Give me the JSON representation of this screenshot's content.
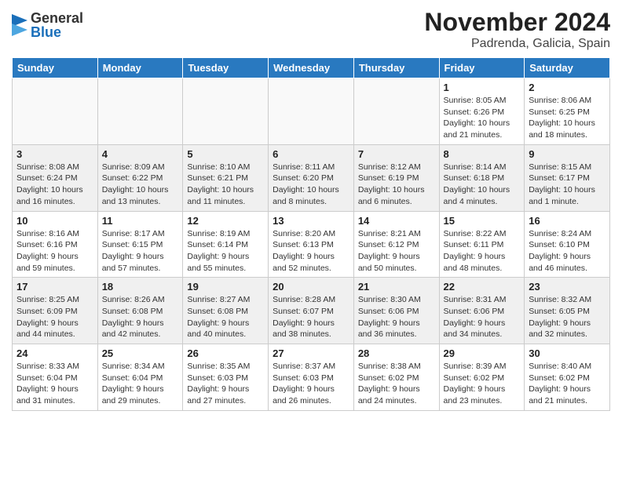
{
  "header": {
    "logo_general": "General",
    "logo_blue": "Blue",
    "month_title": "November 2024",
    "location": "Padrenda, Galicia, Spain"
  },
  "days_of_week": [
    "Sunday",
    "Monday",
    "Tuesday",
    "Wednesday",
    "Thursday",
    "Friday",
    "Saturday"
  ],
  "weeks": [
    [
      {
        "day": "",
        "info": ""
      },
      {
        "day": "",
        "info": ""
      },
      {
        "day": "",
        "info": ""
      },
      {
        "day": "",
        "info": ""
      },
      {
        "day": "",
        "info": ""
      },
      {
        "day": "1",
        "info": "Sunrise: 8:05 AM\nSunset: 6:26 PM\nDaylight: 10 hours and 21 minutes."
      },
      {
        "day": "2",
        "info": "Sunrise: 8:06 AM\nSunset: 6:25 PM\nDaylight: 10 hours and 18 minutes."
      }
    ],
    [
      {
        "day": "3",
        "info": "Sunrise: 8:08 AM\nSunset: 6:24 PM\nDaylight: 10 hours and 16 minutes."
      },
      {
        "day": "4",
        "info": "Sunrise: 8:09 AM\nSunset: 6:22 PM\nDaylight: 10 hours and 13 minutes."
      },
      {
        "day": "5",
        "info": "Sunrise: 8:10 AM\nSunset: 6:21 PM\nDaylight: 10 hours and 11 minutes."
      },
      {
        "day": "6",
        "info": "Sunrise: 8:11 AM\nSunset: 6:20 PM\nDaylight: 10 hours and 8 minutes."
      },
      {
        "day": "7",
        "info": "Sunrise: 8:12 AM\nSunset: 6:19 PM\nDaylight: 10 hours and 6 minutes."
      },
      {
        "day": "8",
        "info": "Sunrise: 8:14 AM\nSunset: 6:18 PM\nDaylight: 10 hours and 4 minutes."
      },
      {
        "day": "9",
        "info": "Sunrise: 8:15 AM\nSunset: 6:17 PM\nDaylight: 10 hours and 1 minute."
      }
    ],
    [
      {
        "day": "10",
        "info": "Sunrise: 8:16 AM\nSunset: 6:16 PM\nDaylight: 9 hours and 59 minutes."
      },
      {
        "day": "11",
        "info": "Sunrise: 8:17 AM\nSunset: 6:15 PM\nDaylight: 9 hours and 57 minutes."
      },
      {
        "day": "12",
        "info": "Sunrise: 8:19 AM\nSunset: 6:14 PM\nDaylight: 9 hours and 55 minutes."
      },
      {
        "day": "13",
        "info": "Sunrise: 8:20 AM\nSunset: 6:13 PM\nDaylight: 9 hours and 52 minutes."
      },
      {
        "day": "14",
        "info": "Sunrise: 8:21 AM\nSunset: 6:12 PM\nDaylight: 9 hours and 50 minutes."
      },
      {
        "day": "15",
        "info": "Sunrise: 8:22 AM\nSunset: 6:11 PM\nDaylight: 9 hours and 48 minutes."
      },
      {
        "day": "16",
        "info": "Sunrise: 8:24 AM\nSunset: 6:10 PM\nDaylight: 9 hours and 46 minutes."
      }
    ],
    [
      {
        "day": "17",
        "info": "Sunrise: 8:25 AM\nSunset: 6:09 PM\nDaylight: 9 hours and 44 minutes."
      },
      {
        "day": "18",
        "info": "Sunrise: 8:26 AM\nSunset: 6:08 PM\nDaylight: 9 hours and 42 minutes."
      },
      {
        "day": "19",
        "info": "Sunrise: 8:27 AM\nSunset: 6:08 PM\nDaylight: 9 hours and 40 minutes."
      },
      {
        "day": "20",
        "info": "Sunrise: 8:28 AM\nSunset: 6:07 PM\nDaylight: 9 hours and 38 minutes."
      },
      {
        "day": "21",
        "info": "Sunrise: 8:30 AM\nSunset: 6:06 PM\nDaylight: 9 hours and 36 minutes."
      },
      {
        "day": "22",
        "info": "Sunrise: 8:31 AM\nSunset: 6:06 PM\nDaylight: 9 hours and 34 minutes."
      },
      {
        "day": "23",
        "info": "Sunrise: 8:32 AM\nSunset: 6:05 PM\nDaylight: 9 hours and 32 minutes."
      }
    ],
    [
      {
        "day": "24",
        "info": "Sunrise: 8:33 AM\nSunset: 6:04 PM\nDaylight: 9 hours and 31 minutes."
      },
      {
        "day": "25",
        "info": "Sunrise: 8:34 AM\nSunset: 6:04 PM\nDaylight: 9 hours and 29 minutes."
      },
      {
        "day": "26",
        "info": "Sunrise: 8:35 AM\nSunset: 6:03 PM\nDaylight: 9 hours and 27 minutes."
      },
      {
        "day": "27",
        "info": "Sunrise: 8:37 AM\nSunset: 6:03 PM\nDaylight: 9 hours and 26 minutes."
      },
      {
        "day": "28",
        "info": "Sunrise: 8:38 AM\nSunset: 6:02 PM\nDaylight: 9 hours and 24 minutes."
      },
      {
        "day": "29",
        "info": "Sunrise: 8:39 AM\nSunset: 6:02 PM\nDaylight: 9 hours and 23 minutes."
      },
      {
        "day": "30",
        "info": "Sunrise: 8:40 AM\nSunset: 6:02 PM\nDaylight: 9 hours and 21 minutes."
      }
    ]
  ]
}
